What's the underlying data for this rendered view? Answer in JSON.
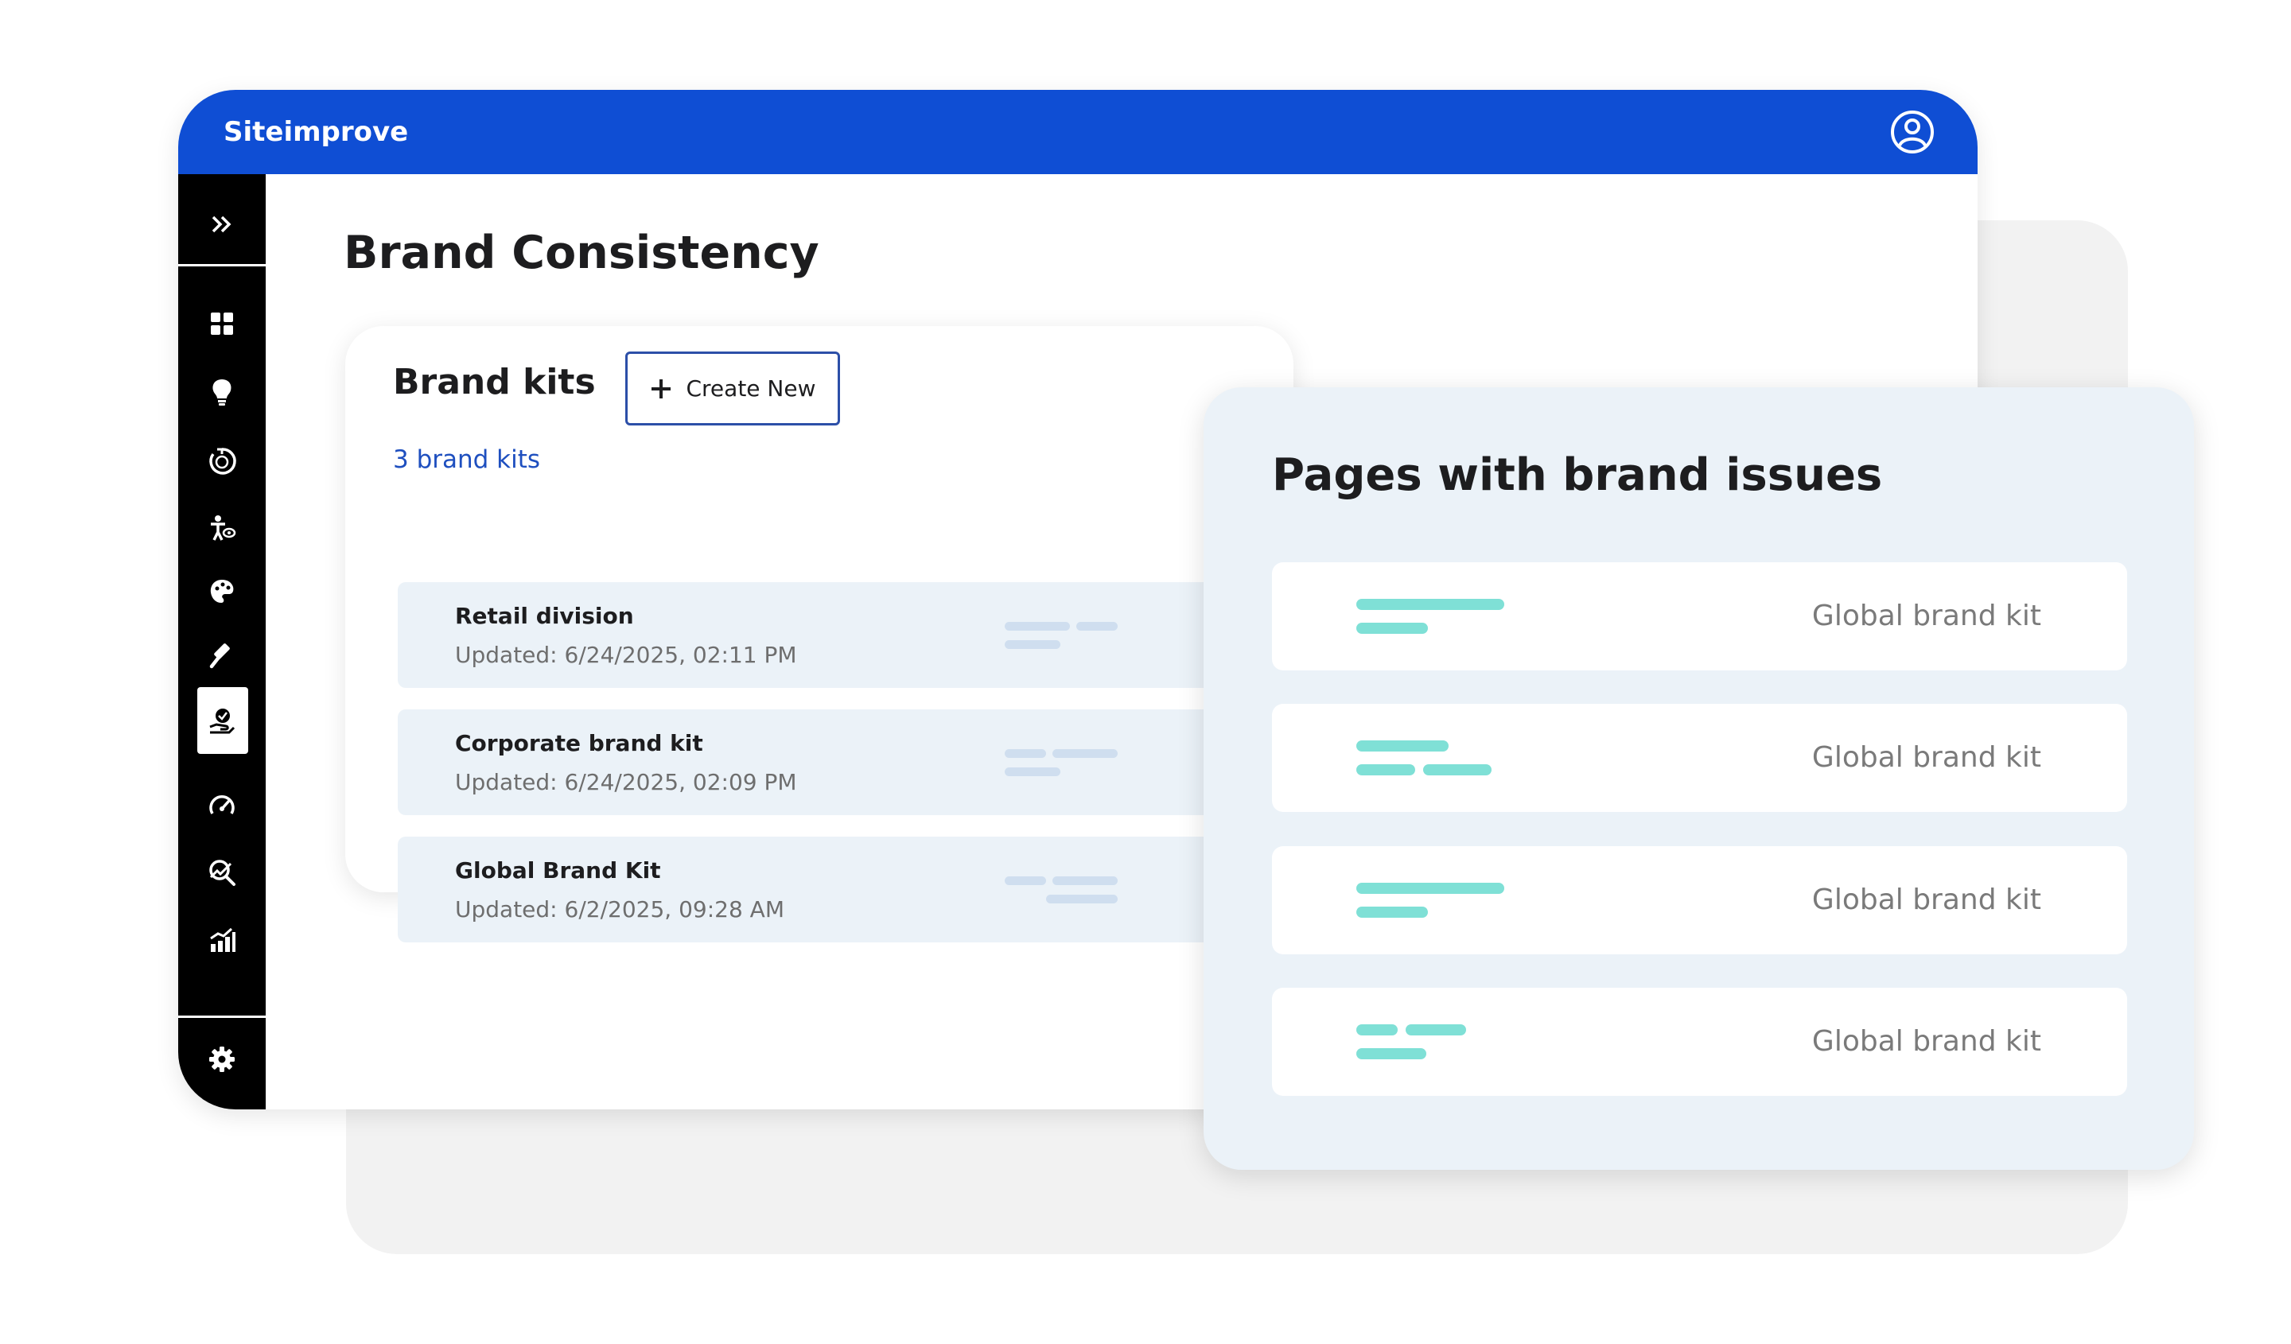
{
  "app": {
    "brand": "Siteimprove"
  },
  "icons": {
    "user": "user-circle-icon",
    "expand": "double-chevron-right-icon",
    "create": "plus-icon",
    "sidebar": [
      "dashboard-icon",
      "lightbulb-icon",
      "dci-icon",
      "accessibility-icon",
      "palette-icon",
      "gavel-icon",
      "brand-consistency-icon",
      "speedometer-icon",
      "seo-search-icon",
      "analytics-chart-icon",
      "gear-icon"
    ]
  },
  "page": {
    "title": "Brand Consistency"
  },
  "brand_kits": {
    "title": "Brand kits",
    "create_label": "Create New",
    "count_label": "3 brand kits",
    "items": [
      {
        "name": "Retail division",
        "updated": "Updated: 6/24/2025, 02:11 PM"
      },
      {
        "name": "Corporate brand kit",
        "updated": "Updated: 6/24/2025, 02:09 PM"
      },
      {
        "name": "Global Brand Kit",
        "updated": "Updated: 6/2/2025, 09:28 AM"
      }
    ]
  },
  "issues": {
    "title": "Pages with brand issues",
    "rows": [
      {
        "kit": "Global brand kit"
      },
      {
        "kit": "Global brand kit"
      },
      {
        "kit": "Global brand kit"
      },
      {
        "kit": "Global brand kit"
      }
    ]
  },
  "colors": {
    "topbar": "#0f4ed4",
    "sidebar": "#000000",
    "link": "#1e4fbf",
    "row_bg": "#ebf2f8",
    "teal_bar": "#7fe0d6"
  }
}
